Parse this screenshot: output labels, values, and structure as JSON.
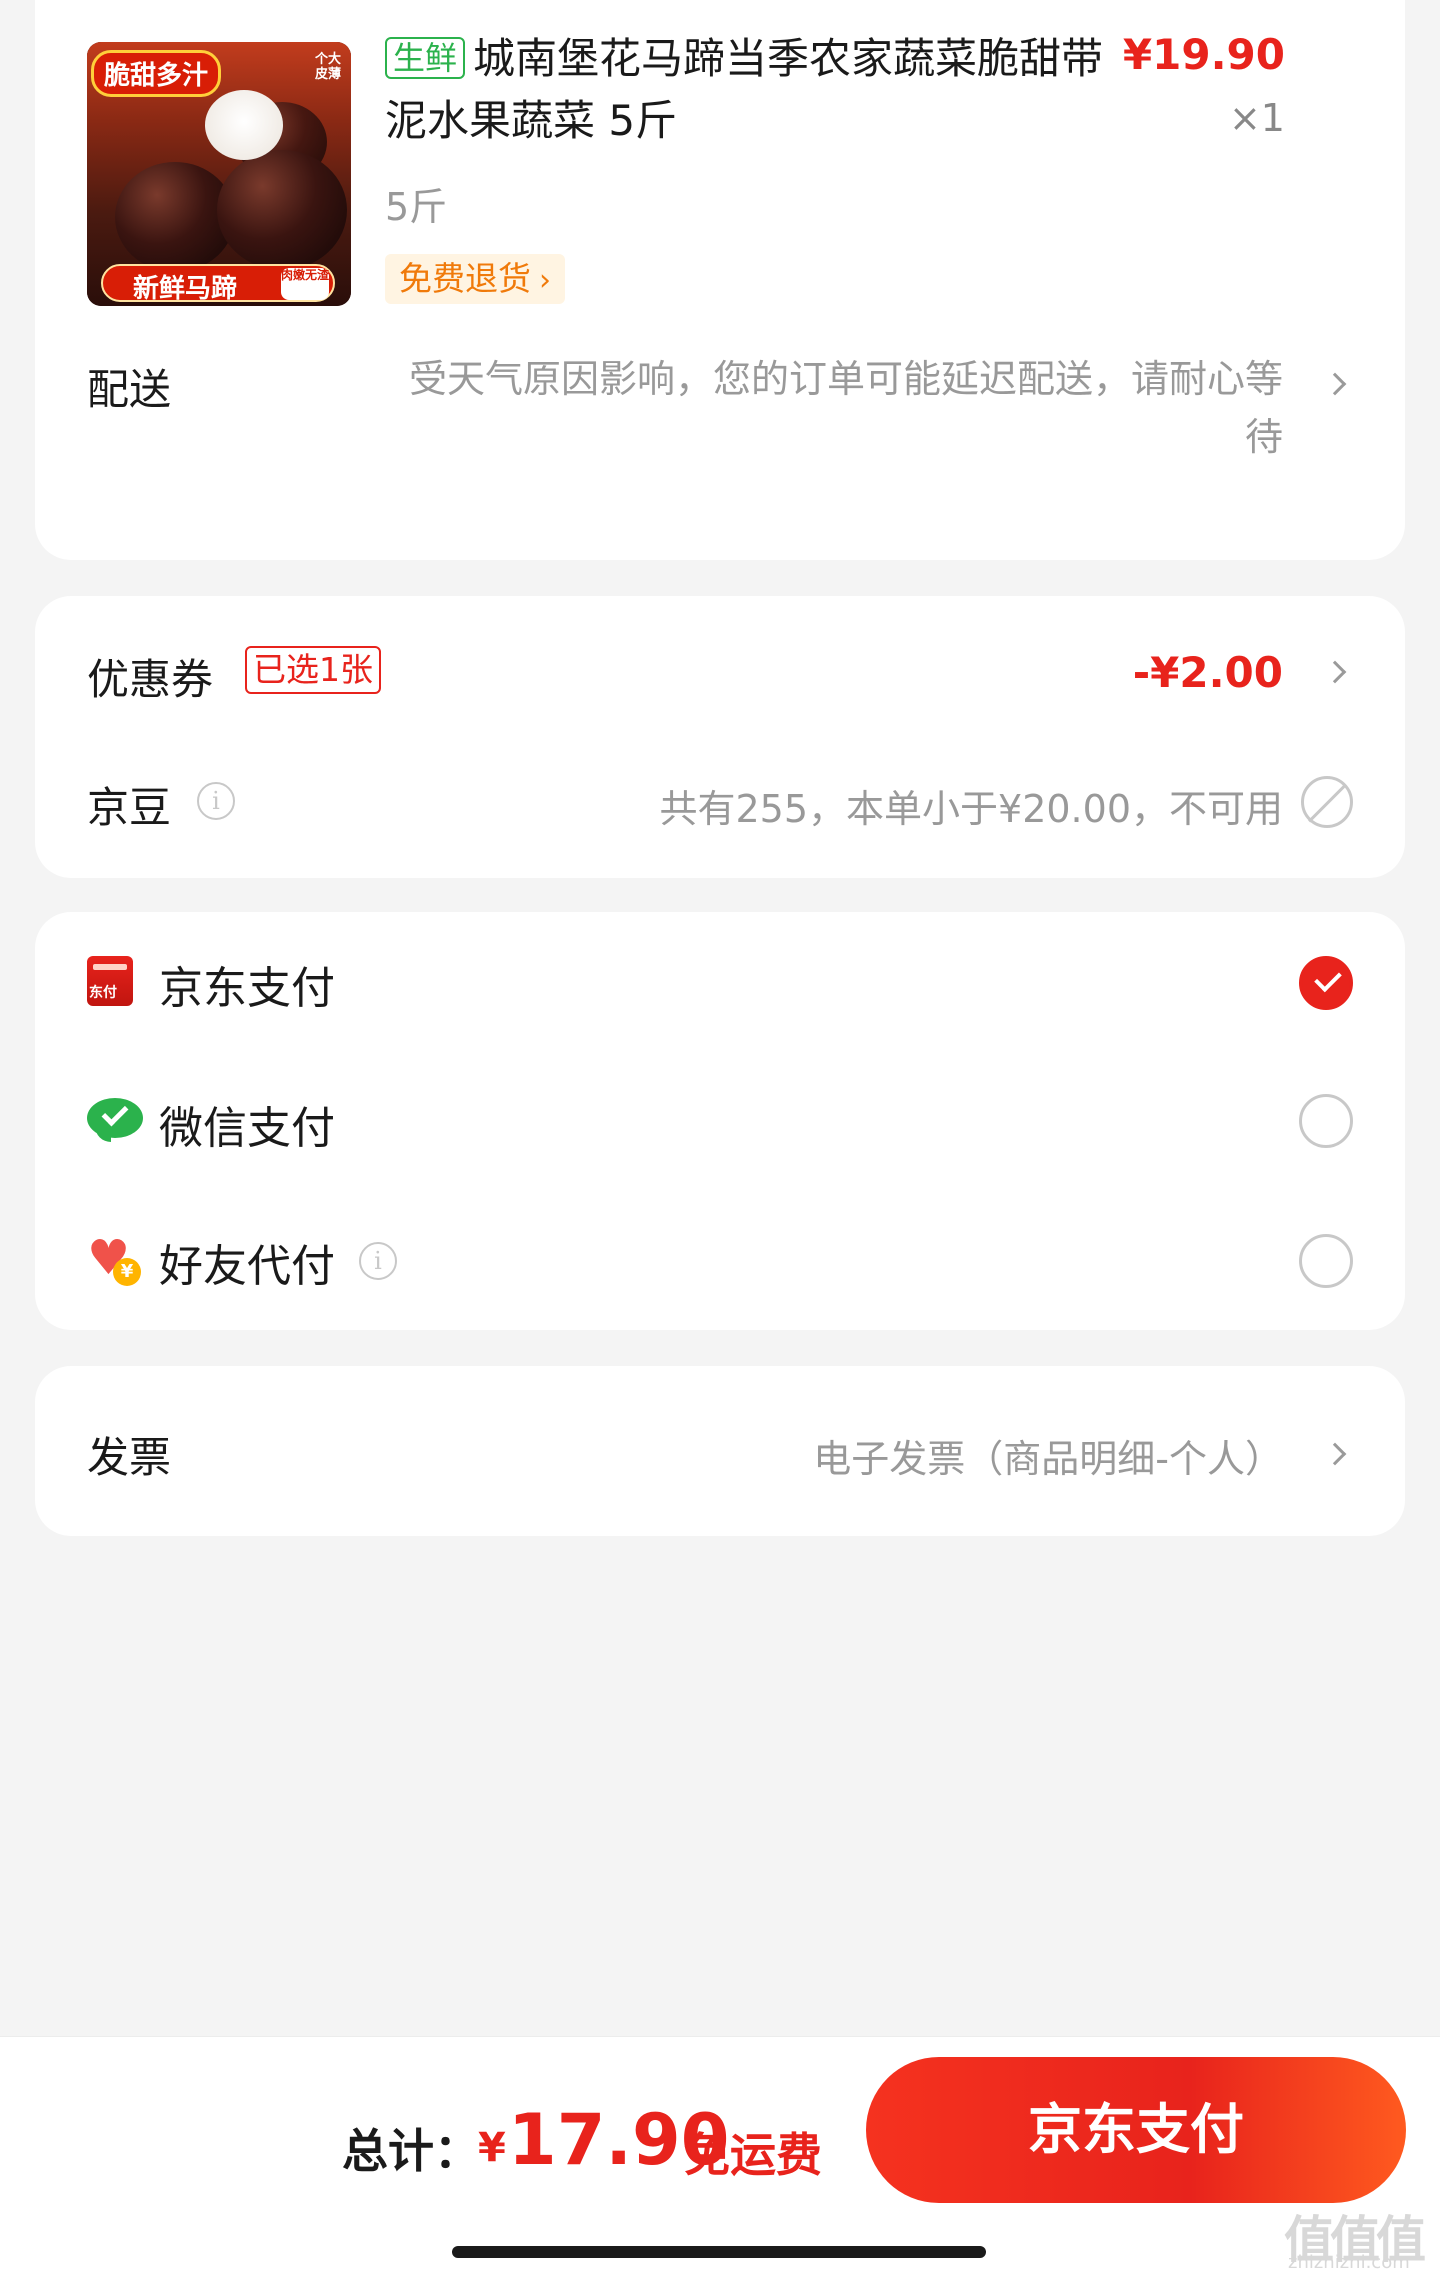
{
  "product": {
    "image_tag_top_left": "脆甜多汁",
    "image_tag_top_right": "个大皮薄",
    "image_banner": "新鲜马蹄",
    "image_banner_side": "肉嫩无渣",
    "fresh_badge": "生鲜",
    "title": "城南堡花马蹄当季农家蔬菜脆甜带泥水果蔬菜 5斤",
    "price": "¥19.90",
    "quantity": "×1",
    "spec": "5斤",
    "return_tag": "免费退货"
  },
  "delivery": {
    "label": "配送",
    "note": "受天气原因影响，您的订单可能延迟配送，请耐心等待"
  },
  "coupon": {
    "label": "优惠券",
    "badge": "已选1张",
    "amount": "-¥2.00"
  },
  "beans": {
    "label": "京豆",
    "note": "共有255，本单小于¥20.00，不可用"
  },
  "payment_methods": [
    {
      "label": "京东支付",
      "icon": "jd-pay-icon",
      "selected": true,
      "icon_text": "东付"
    },
    {
      "label": "微信支付",
      "icon": "wechat-pay-icon",
      "selected": false
    },
    {
      "label": "好友代付",
      "icon": "friend-pay-icon",
      "selected": false,
      "icon_text": "¥"
    }
  ],
  "invoice": {
    "label": "发票",
    "value": "电子发票（商品明细-个人）"
  },
  "footer": {
    "total_label": "总计：",
    "currency": "¥",
    "total_amount": "17.90",
    "free_shipping": "免运费",
    "pay_button": "京东支付"
  },
  "watermark": {
    "main": "值值值",
    "sub": "zhizhizhi.com"
  },
  "colors": {
    "accent_red": "#e8231c",
    "fresh_green": "#2bb24c",
    "return_orange": "#f07a0a"
  }
}
